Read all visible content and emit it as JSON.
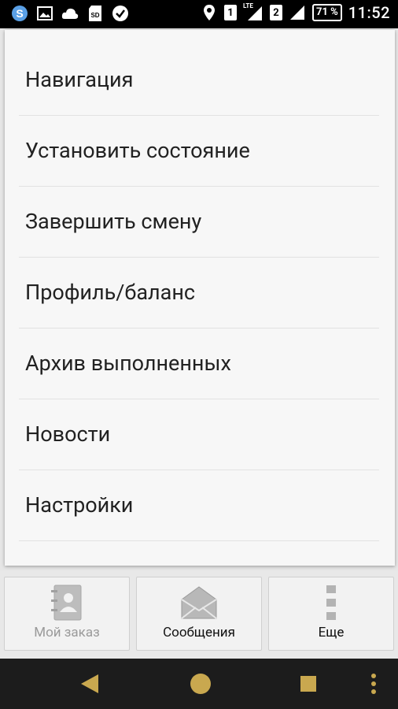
{
  "status_bar": {
    "left_icons": [
      "skype-icon",
      "image-icon",
      "cloud-icon",
      "sd-card-icon",
      "check-circle-icon"
    ],
    "right_icons": [
      "location-icon",
      "signal-icon",
      "signal-icon"
    ],
    "sim1": "1",
    "sim2": "2",
    "lte": "LTE",
    "battery": "71 %",
    "time": "11:52"
  },
  "menu": {
    "items": [
      {
        "label": "Навигация"
      },
      {
        "label": "Установить состояние"
      },
      {
        "label": "Завершить смену"
      },
      {
        "label": "Профиль/баланс"
      },
      {
        "label": "Архив выполненных"
      },
      {
        "label": "Новости"
      },
      {
        "label": "Настройки"
      }
    ]
  },
  "tabs": [
    {
      "label": "Мой заказ",
      "icon": "contacts-book-icon",
      "enabled": false
    },
    {
      "label": "Сообщения",
      "icon": "envelope-icon",
      "enabled": true
    },
    {
      "label": "Еще",
      "icon": "more-dots-icon",
      "enabled": true
    }
  ],
  "nav_bar": {
    "icons": [
      "back-icon",
      "home-icon",
      "recents-icon",
      "menu-dots-icon"
    ],
    "accent": "#c9a84f"
  }
}
